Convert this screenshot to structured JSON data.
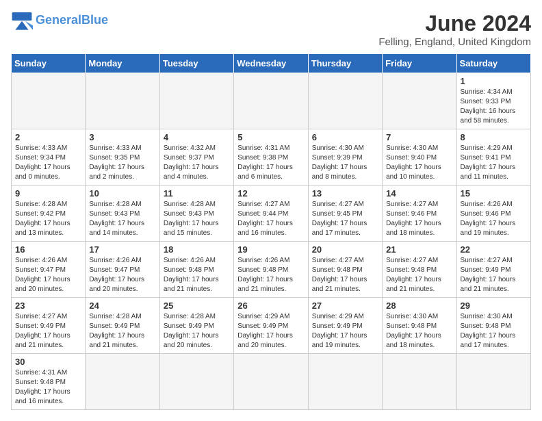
{
  "header": {
    "logo_general": "General",
    "logo_blue": "Blue",
    "month_title": "June 2024",
    "location": "Felling, England, United Kingdom"
  },
  "days_of_week": [
    "Sunday",
    "Monday",
    "Tuesday",
    "Wednesday",
    "Thursday",
    "Friday",
    "Saturday"
  ],
  "weeks": [
    [
      {
        "day": "",
        "info": ""
      },
      {
        "day": "",
        "info": ""
      },
      {
        "day": "",
        "info": ""
      },
      {
        "day": "",
        "info": ""
      },
      {
        "day": "",
        "info": ""
      },
      {
        "day": "",
        "info": ""
      },
      {
        "day": "1",
        "info": "Sunrise: 4:34 AM\nSunset: 9:33 PM\nDaylight: 16 hours\nand 58 minutes."
      }
    ],
    [
      {
        "day": "2",
        "info": "Sunrise: 4:33 AM\nSunset: 9:34 PM\nDaylight: 17 hours\nand 0 minutes."
      },
      {
        "day": "3",
        "info": "Sunrise: 4:33 AM\nSunset: 9:35 PM\nDaylight: 17 hours\nand 2 minutes."
      },
      {
        "day": "4",
        "info": "Sunrise: 4:32 AM\nSunset: 9:37 PM\nDaylight: 17 hours\nand 4 minutes."
      },
      {
        "day": "5",
        "info": "Sunrise: 4:31 AM\nSunset: 9:38 PM\nDaylight: 17 hours\nand 6 minutes."
      },
      {
        "day": "6",
        "info": "Sunrise: 4:30 AM\nSunset: 9:39 PM\nDaylight: 17 hours\nand 8 minutes."
      },
      {
        "day": "7",
        "info": "Sunrise: 4:30 AM\nSunset: 9:40 PM\nDaylight: 17 hours\nand 10 minutes."
      },
      {
        "day": "8",
        "info": "Sunrise: 4:29 AM\nSunset: 9:41 PM\nDaylight: 17 hours\nand 11 minutes."
      }
    ],
    [
      {
        "day": "9",
        "info": "Sunrise: 4:28 AM\nSunset: 9:42 PM\nDaylight: 17 hours\nand 13 minutes."
      },
      {
        "day": "10",
        "info": "Sunrise: 4:28 AM\nSunset: 9:43 PM\nDaylight: 17 hours\nand 14 minutes."
      },
      {
        "day": "11",
        "info": "Sunrise: 4:28 AM\nSunset: 9:43 PM\nDaylight: 17 hours\nand 15 minutes."
      },
      {
        "day": "12",
        "info": "Sunrise: 4:27 AM\nSunset: 9:44 PM\nDaylight: 17 hours\nand 16 minutes."
      },
      {
        "day": "13",
        "info": "Sunrise: 4:27 AM\nSunset: 9:45 PM\nDaylight: 17 hours\nand 17 minutes."
      },
      {
        "day": "14",
        "info": "Sunrise: 4:27 AM\nSunset: 9:46 PM\nDaylight: 17 hours\nand 18 minutes."
      },
      {
        "day": "15",
        "info": "Sunrise: 4:26 AM\nSunset: 9:46 PM\nDaylight: 17 hours\nand 19 minutes."
      }
    ],
    [
      {
        "day": "16",
        "info": "Sunrise: 4:26 AM\nSunset: 9:47 PM\nDaylight: 17 hours\nand 20 minutes."
      },
      {
        "day": "17",
        "info": "Sunrise: 4:26 AM\nSunset: 9:47 PM\nDaylight: 17 hours\nand 20 minutes."
      },
      {
        "day": "18",
        "info": "Sunrise: 4:26 AM\nSunset: 9:48 PM\nDaylight: 17 hours\nand 21 minutes."
      },
      {
        "day": "19",
        "info": "Sunrise: 4:26 AM\nSunset: 9:48 PM\nDaylight: 17 hours\nand 21 minutes."
      },
      {
        "day": "20",
        "info": "Sunrise: 4:27 AM\nSunset: 9:48 PM\nDaylight: 17 hours\nand 21 minutes."
      },
      {
        "day": "21",
        "info": "Sunrise: 4:27 AM\nSunset: 9:48 PM\nDaylight: 17 hours\nand 21 minutes."
      },
      {
        "day": "22",
        "info": "Sunrise: 4:27 AM\nSunset: 9:49 PM\nDaylight: 17 hours\nand 21 minutes."
      }
    ],
    [
      {
        "day": "23",
        "info": "Sunrise: 4:27 AM\nSunset: 9:49 PM\nDaylight: 17 hours\nand 21 minutes."
      },
      {
        "day": "24",
        "info": "Sunrise: 4:28 AM\nSunset: 9:49 PM\nDaylight: 17 hours\nand 21 minutes."
      },
      {
        "day": "25",
        "info": "Sunrise: 4:28 AM\nSunset: 9:49 PM\nDaylight: 17 hours\nand 20 minutes."
      },
      {
        "day": "26",
        "info": "Sunrise: 4:29 AM\nSunset: 9:49 PM\nDaylight: 17 hours\nand 20 minutes."
      },
      {
        "day": "27",
        "info": "Sunrise: 4:29 AM\nSunset: 9:49 PM\nDaylight: 17 hours\nand 19 minutes."
      },
      {
        "day": "28",
        "info": "Sunrise: 4:30 AM\nSunset: 9:48 PM\nDaylight: 17 hours\nand 18 minutes."
      },
      {
        "day": "29",
        "info": "Sunrise: 4:30 AM\nSunset: 9:48 PM\nDaylight: 17 hours\nand 17 minutes."
      }
    ],
    [
      {
        "day": "30",
        "info": "Sunrise: 4:31 AM\nSunset: 9:48 PM\nDaylight: 17 hours\nand 16 minutes."
      },
      {
        "day": "",
        "info": ""
      },
      {
        "day": "",
        "info": ""
      },
      {
        "day": "",
        "info": ""
      },
      {
        "day": "",
        "info": ""
      },
      {
        "day": "",
        "info": ""
      },
      {
        "day": "",
        "info": ""
      }
    ]
  ]
}
